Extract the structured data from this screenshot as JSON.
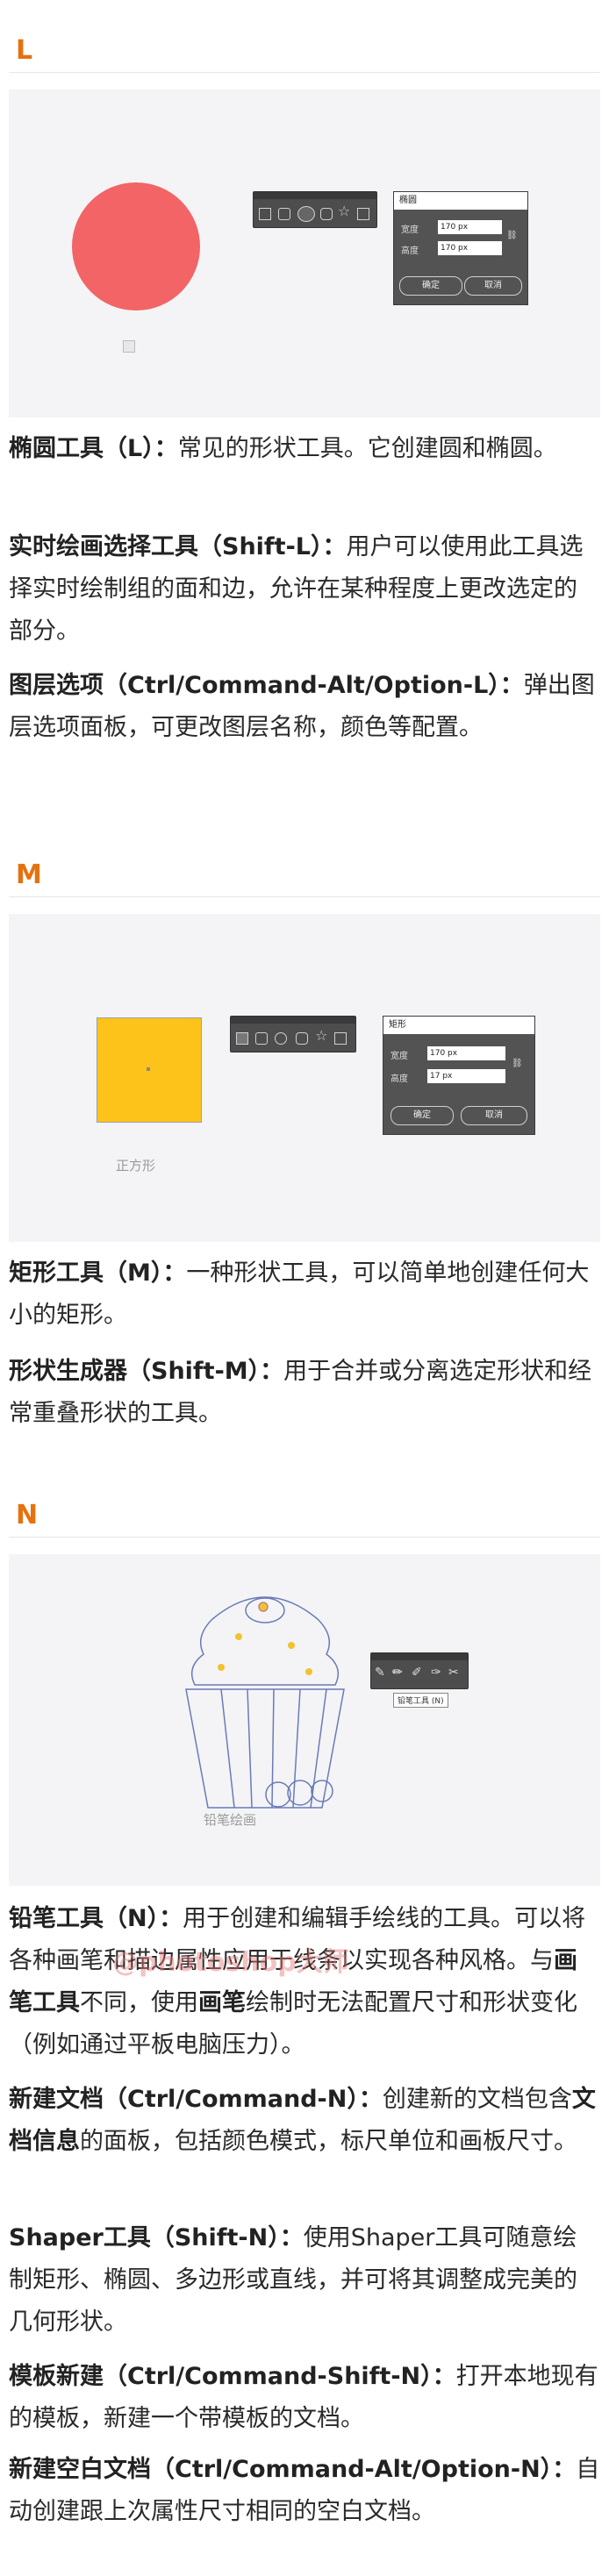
{
  "sections": {
    "L": {
      "letter": "L",
      "dialog": {
        "title": "椭圆",
        "width_label": "宽度",
        "height_label": "高度",
        "width_value": "170 px",
        "height_value": "170 px",
        "ok": "确定",
        "cancel": "取消"
      },
      "paras": [
        {
          "head": "椭圆工具（L）：",
          "body": "常见的形状工具。它创建圆和椭圆。"
        },
        {
          "head": "实时绘画选择工具（Shift-L）：",
          "body": "用户可以使用此工具选择实时绘制组的面和边，允许在某种程度上更改选定的部分。"
        },
        {
          "head": "图层选项（Ctrl/Command-Alt/Option-L）：",
          "body": "弹出图层选项面板，可更改图层名称，颜色等配置。"
        }
      ]
    },
    "M": {
      "letter": "M",
      "caption": "正方形",
      "dialog": {
        "title": "矩形",
        "width_label": "宽度",
        "height_label": "高度",
        "width_value": "170 px",
        "height_value": "17 px",
        "ok": "确定",
        "cancel": "取消"
      },
      "paras": [
        {
          "head": "矩形工具（M）：",
          "body": "一种形状工具，可以简单地创建任何大小的矩形。"
        },
        {
          "head": "形状生成器（Shift-M）：",
          "body": "用于合并或分离选定形状和经常重叠形状的工具。"
        }
      ]
    },
    "N": {
      "letter": "N",
      "caption": "铅笔绘画",
      "tooltip": "铅笔工具 (N)",
      "watermark": "@photoshop大师",
      "paras": [
        {
          "head": "铅笔工具（N）：",
          "body_parts": [
            "用于创建和编辑手绘线的工具。可以将各种画笔和描边属性应用于线条以实现各种风格。与",
            "画笔工具",
            "不同，使用",
            "画笔",
            "绘制时无法配置尺寸和形状变化（例如通过平板电脑压力）。"
          ]
        },
        {
          "head": "新建文档（Ctrl/Command-N）：",
          "body_parts": [
            "创建新的文档包含",
            "文档信息",
            "的面板，包括颜色模式，标尺单位和画板尺寸。"
          ]
        },
        {
          "head": "Shaper工具（Shift-N）：",
          "body": "使用Shaper工具可随意绘制矩形、椭圆、多边形或直线，并可将其调整成完美的几何形状。"
        },
        {
          "head": "模板新建（Ctrl/Command-Shift-N）：",
          "body": "打开本地现有的模板，新建一个带模板的文档。"
        },
        {
          "head": "新建空白文档（Ctrl/Command-Alt/Option-N）：",
          "body": "自动创建跟上次属性尺寸相同的空白文档。"
        }
      ]
    }
  },
  "colors": {
    "accent": "#e5720f",
    "circle": "#f26465",
    "square": "#fdc31a"
  }
}
